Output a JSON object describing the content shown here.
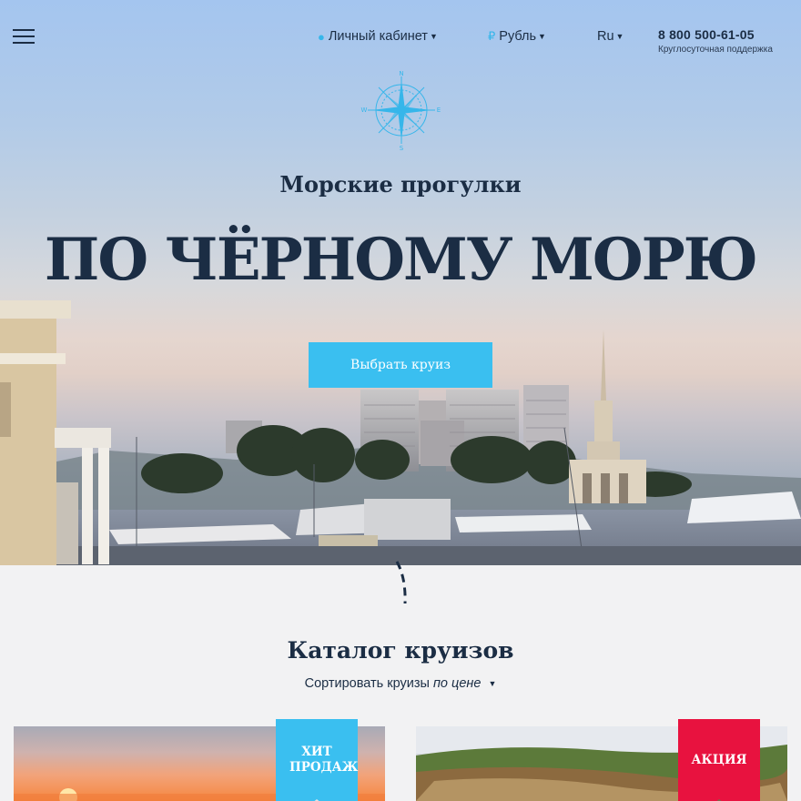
{
  "header": {
    "account_label": "Личный кабинет",
    "currency_label": "Рубль",
    "language_label": "Ru",
    "phone": "8 800 500-61-05",
    "phone_note": "Круглосуточная поддержка"
  },
  "compass": {
    "n": "N",
    "s": "S",
    "w": "W",
    "e": "E"
  },
  "hero": {
    "subtitle": "Морские прогулки",
    "headline": "ПО ЧЁРНОМУ МОРЮ",
    "cta_label": "Выбрать круиз"
  },
  "catalog": {
    "title": "Каталог круизов",
    "sort_prefix": "Сортировать круизы",
    "sort_value": "по цене",
    "cards": [
      {
        "badge": "ХИТ ПРОДАЖ",
        "badge_color": "#3abff0"
      },
      {
        "badge": "АКЦИЯ",
        "badge_color": "#e8123f"
      }
    ]
  },
  "colors": {
    "accent": "#3abff0",
    "text": "#1b2d44",
    "sale": "#e8123f"
  }
}
